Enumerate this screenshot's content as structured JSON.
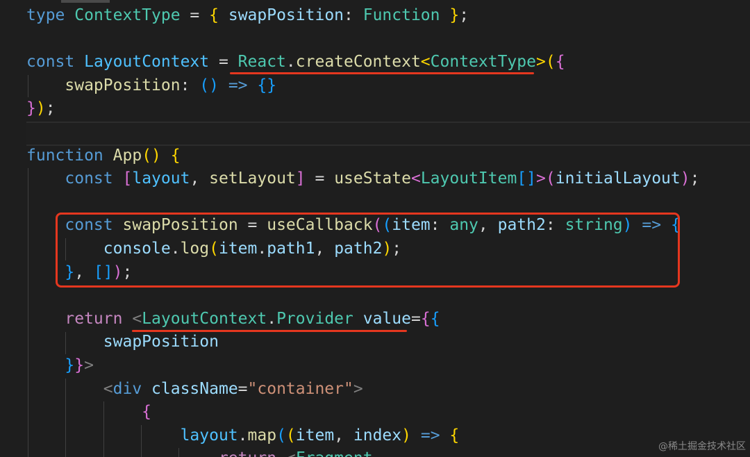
{
  "colors": {
    "background": "#1e1e1e",
    "keyword": "#569cd6",
    "type": "#4ec9b0",
    "function": "#dcdcaa",
    "variable": "#9cdcfe",
    "punctuation": "#d4d4d4",
    "bracket_gold": "#ffd700",
    "bracket_pink": "#da70d6",
    "bracket_blue": "#179fff",
    "control": "#c586c0",
    "string": "#ce9178",
    "tag_bracket": "#808080",
    "const_var": "#4fc1ff",
    "annotation_red": "#e5371f"
  },
  "code_lines": [
    {
      "tokens": [
        [
          "type",
          "keyword"
        ],
        [
          " ",
          "punctuation"
        ],
        [
          "ContextType",
          "type"
        ],
        [
          " = ",
          "punctuation"
        ],
        [
          "{",
          "bracket_gold"
        ],
        [
          " ",
          "punctuation"
        ],
        [
          "swapPosition",
          "variable"
        ],
        [
          ": ",
          "punctuation"
        ],
        [
          "Function",
          "type"
        ],
        [
          " ",
          "punctuation"
        ],
        [
          "}",
          "bracket_gold"
        ],
        [
          ";",
          "punctuation"
        ]
      ]
    },
    {
      "tokens": []
    },
    {
      "tokens": [
        [
          "const",
          "keyword"
        ],
        [
          " ",
          "punctuation"
        ],
        [
          "LayoutContext",
          "const_var"
        ],
        [
          " = ",
          "punctuation"
        ],
        [
          "React",
          "type"
        ],
        [
          ".",
          "punctuation"
        ],
        [
          "createContext",
          "function"
        ],
        [
          "<",
          "bracket_gold"
        ],
        [
          "ContextType",
          "type"
        ],
        [
          ">",
          "bracket_gold"
        ],
        [
          "(",
          "bracket_gold"
        ],
        [
          "{",
          "bracket_pink"
        ]
      ]
    },
    {
      "tokens": [
        [
          "    ",
          "punctuation"
        ],
        [
          "swapPosition",
          "function"
        ],
        [
          ": ",
          "punctuation"
        ],
        [
          "()",
          "bracket_blue"
        ],
        [
          " ",
          "punctuation"
        ],
        [
          "=>",
          "keyword"
        ],
        [
          " ",
          "punctuation"
        ],
        [
          "{}",
          "bracket_blue"
        ]
      ]
    },
    {
      "tokens": [
        [
          "}",
          "bracket_pink"
        ],
        [
          ")",
          "bracket_gold"
        ],
        [
          ";",
          "punctuation"
        ]
      ]
    },
    {
      "tokens": []
    },
    {
      "tokens": [
        [
          "function",
          "keyword"
        ],
        [
          " ",
          "punctuation"
        ],
        [
          "App",
          "function"
        ],
        [
          "()",
          "bracket_gold"
        ],
        [
          " ",
          "punctuation"
        ],
        [
          "{",
          "bracket_gold"
        ]
      ]
    },
    {
      "tokens": [
        [
          "    ",
          "punctuation"
        ],
        [
          "const",
          "keyword"
        ],
        [
          " ",
          "punctuation"
        ],
        [
          "[",
          "bracket_pink"
        ],
        [
          "layout",
          "const_var"
        ],
        [
          ", ",
          "punctuation"
        ],
        [
          "setLayout",
          "function"
        ],
        [
          "]",
          "bracket_pink"
        ],
        [
          " = ",
          "punctuation"
        ],
        [
          "useState",
          "function"
        ],
        [
          "<",
          "bracket_pink"
        ],
        [
          "LayoutItem",
          "type"
        ],
        [
          "[]",
          "bracket_blue"
        ],
        [
          ">",
          "bracket_pink"
        ],
        [
          "(",
          "bracket_pink"
        ],
        [
          "initialLayout",
          "variable"
        ],
        [
          ")",
          "bracket_pink"
        ],
        [
          ";",
          "punctuation"
        ]
      ]
    },
    {
      "tokens": []
    },
    {
      "tokens": [
        [
          "    ",
          "punctuation"
        ],
        [
          "const",
          "keyword"
        ],
        [
          " ",
          "punctuation"
        ],
        [
          "swapPosition",
          "function"
        ],
        [
          " = ",
          "punctuation"
        ],
        [
          "useCallback",
          "function"
        ],
        [
          "(",
          "bracket_pink"
        ],
        [
          "(",
          "bracket_blue"
        ],
        [
          "item",
          "variable"
        ],
        [
          ": ",
          "punctuation"
        ],
        [
          "any",
          "type"
        ],
        [
          ", ",
          "punctuation"
        ],
        [
          "path2",
          "variable"
        ],
        [
          ": ",
          "punctuation"
        ],
        [
          "string",
          "type"
        ],
        [
          ")",
          "bracket_blue"
        ],
        [
          " ",
          "punctuation"
        ],
        [
          "=>",
          "keyword"
        ],
        [
          " ",
          "punctuation"
        ],
        [
          "{",
          "bracket_blue"
        ]
      ]
    },
    {
      "tokens": [
        [
          "        ",
          "punctuation"
        ],
        [
          "console",
          "variable"
        ],
        [
          ".",
          "punctuation"
        ],
        [
          "log",
          "function"
        ],
        [
          "(",
          "bracket_gold"
        ],
        [
          "item",
          "variable"
        ],
        [
          ".",
          "punctuation"
        ],
        [
          "path1",
          "variable"
        ],
        [
          ", ",
          "punctuation"
        ],
        [
          "path2",
          "variable"
        ],
        [
          ")",
          "bracket_gold"
        ],
        [
          ";",
          "punctuation"
        ]
      ]
    },
    {
      "tokens": [
        [
          "    ",
          "punctuation"
        ],
        [
          "}",
          "bracket_blue"
        ],
        [
          ", ",
          "punctuation"
        ],
        [
          "[]",
          "bracket_blue"
        ],
        [
          ")",
          "bracket_pink"
        ],
        [
          ";",
          "punctuation"
        ]
      ]
    },
    {
      "tokens": []
    },
    {
      "tokens": [
        [
          "    ",
          "punctuation"
        ],
        [
          "return",
          "control"
        ],
        [
          " ",
          "punctuation"
        ],
        [
          "<",
          "tag_bracket"
        ],
        [
          "LayoutContext",
          "type"
        ],
        [
          ".",
          "punctuation"
        ],
        [
          "Provider",
          "type"
        ],
        [
          " ",
          "punctuation"
        ],
        [
          "value",
          "variable"
        ],
        [
          "=",
          "punctuation"
        ],
        [
          "{",
          "bracket_pink"
        ],
        [
          "{",
          "bracket_blue"
        ]
      ]
    },
    {
      "tokens": [
        [
          "        ",
          "punctuation"
        ],
        [
          "swapPosition",
          "variable"
        ]
      ]
    },
    {
      "tokens": [
        [
          "    ",
          "punctuation"
        ],
        [
          "}",
          "bracket_blue"
        ],
        [
          "}",
          "bracket_pink"
        ],
        [
          ">",
          "tag_bracket"
        ]
      ]
    },
    {
      "tokens": [
        [
          "        ",
          "punctuation"
        ],
        [
          "<",
          "tag_bracket"
        ],
        [
          "div",
          "keyword"
        ],
        [
          " ",
          "punctuation"
        ],
        [
          "className",
          "variable"
        ],
        [
          "=",
          "punctuation"
        ],
        [
          "\"container\"",
          "string"
        ],
        [
          ">",
          "tag_bracket"
        ]
      ]
    },
    {
      "tokens": [
        [
          "            ",
          "punctuation"
        ],
        [
          "{",
          "bracket_pink"
        ]
      ]
    },
    {
      "tokens": [
        [
          "                ",
          "punctuation"
        ],
        [
          "layout",
          "const_var"
        ],
        [
          ".",
          "punctuation"
        ],
        [
          "map",
          "function"
        ],
        [
          "(",
          "bracket_blue"
        ],
        [
          "(",
          "bracket_gold"
        ],
        [
          "item",
          "variable"
        ],
        [
          ", ",
          "punctuation"
        ],
        [
          "index",
          "variable"
        ],
        [
          ")",
          "bracket_gold"
        ],
        [
          " ",
          "punctuation"
        ],
        [
          "=>",
          "keyword"
        ],
        [
          " ",
          "punctuation"
        ],
        [
          "{",
          "bracket_gold"
        ]
      ]
    },
    {
      "tokens": [
        [
          "                    ",
          "punctuation"
        ],
        [
          "return",
          "control"
        ],
        [
          " ",
          "punctuation"
        ],
        [
          "<",
          "tag_bracket"
        ],
        [
          "Fragment",
          "type"
        ]
      ]
    }
  ],
  "watermark": "@稀土掘金技术社区"
}
